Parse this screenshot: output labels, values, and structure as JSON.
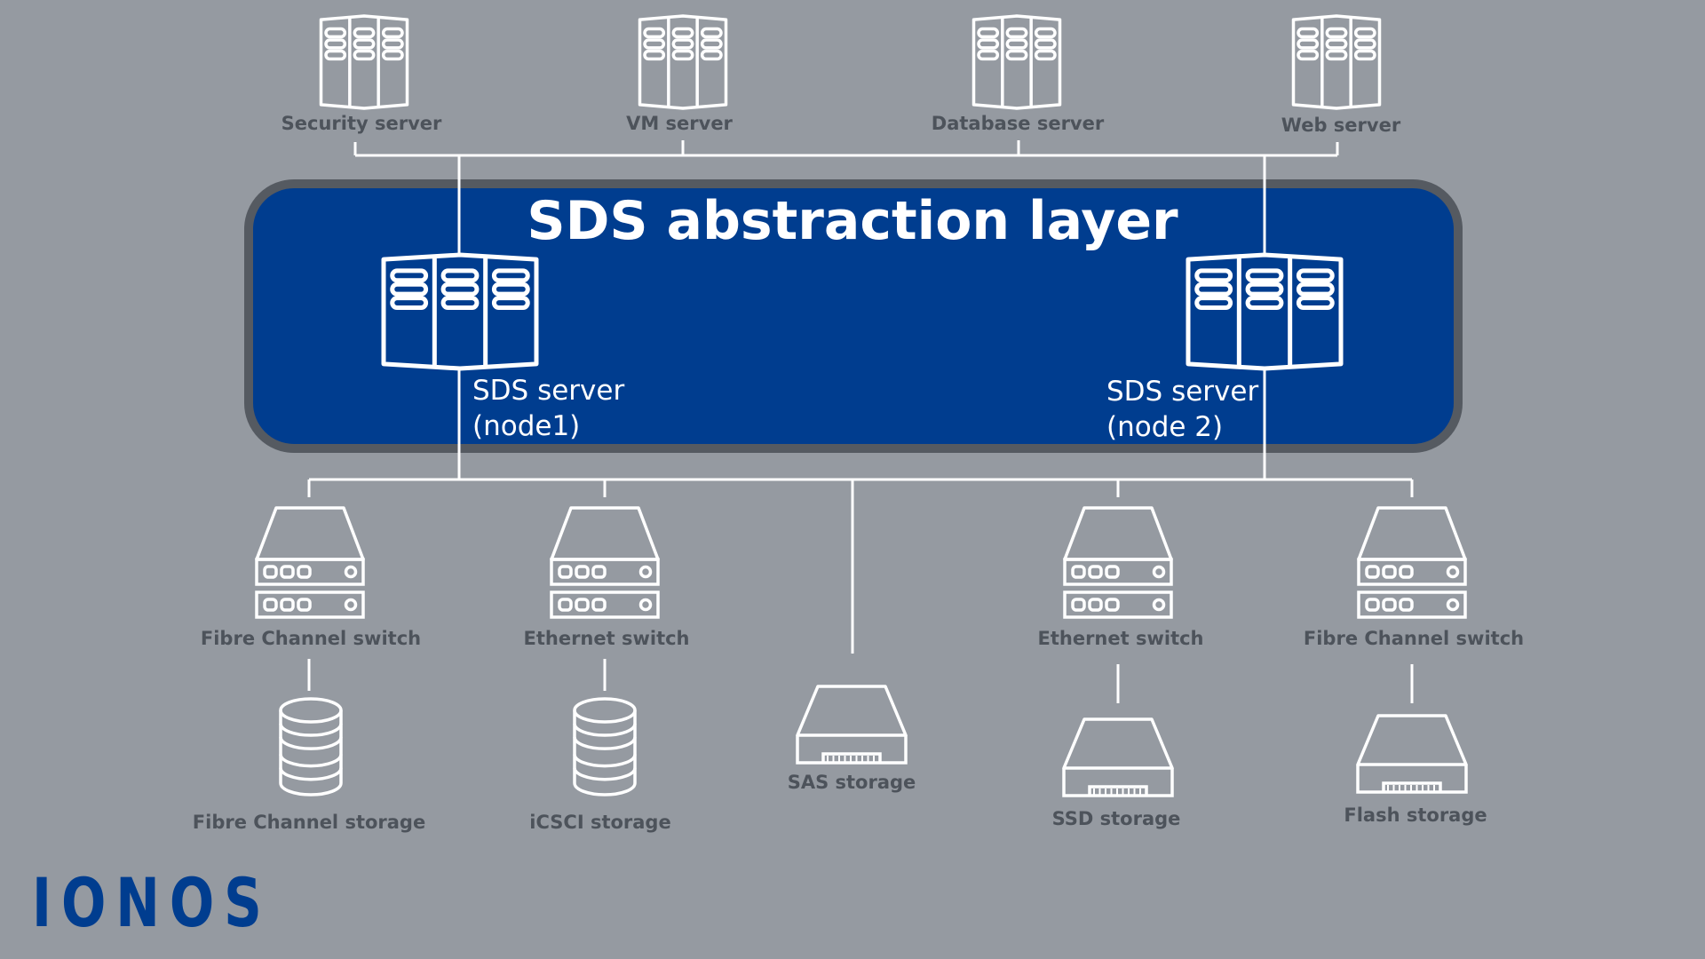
{
  "layer": {
    "title": "SDS abstraction layer"
  },
  "top_servers": [
    {
      "label": "Security server",
      "icon": "server-rack-icon"
    },
    {
      "label": "VM server",
      "icon": "server-rack-icon"
    },
    {
      "label": "Database server",
      "icon": "server-rack-icon"
    },
    {
      "label": "Web server",
      "icon": "server-rack-icon"
    }
  ],
  "sds_nodes": [
    {
      "line1": "SDS server",
      "line2": "(node1)",
      "icon": "server-rack-icon"
    },
    {
      "line1": "SDS server",
      "line2": "(node 2)",
      "icon": "server-rack-icon"
    }
  ],
  "switches": [
    {
      "label": "Fibre Channel switch",
      "icon": "network-switch-icon"
    },
    {
      "label": "Ethernet switch",
      "icon": "network-switch-icon"
    },
    {
      "label": "Ethernet switch",
      "icon": "network-switch-icon"
    },
    {
      "label": "Fibre Channel switch",
      "icon": "network-switch-icon"
    }
  ],
  "storage": [
    {
      "label": "Fibre Channel storage",
      "icon": "database-cylinder-icon"
    },
    {
      "label": "iCSCI storage",
      "icon": "database-cylinder-icon"
    },
    {
      "label": "SAS storage",
      "icon": "drive-icon"
    },
    {
      "label": "SSD storage",
      "icon": "drive-icon"
    },
    {
      "label": "Flash storage",
      "icon": "drive-icon"
    }
  ],
  "brand": {
    "logo": "IONOS",
    "colors": {
      "background": "#959aa1",
      "layer_blue": "#003d8f",
      "layer_border": "#555a61",
      "label_text": "#4d535b",
      "line": "#ffffff"
    }
  }
}
